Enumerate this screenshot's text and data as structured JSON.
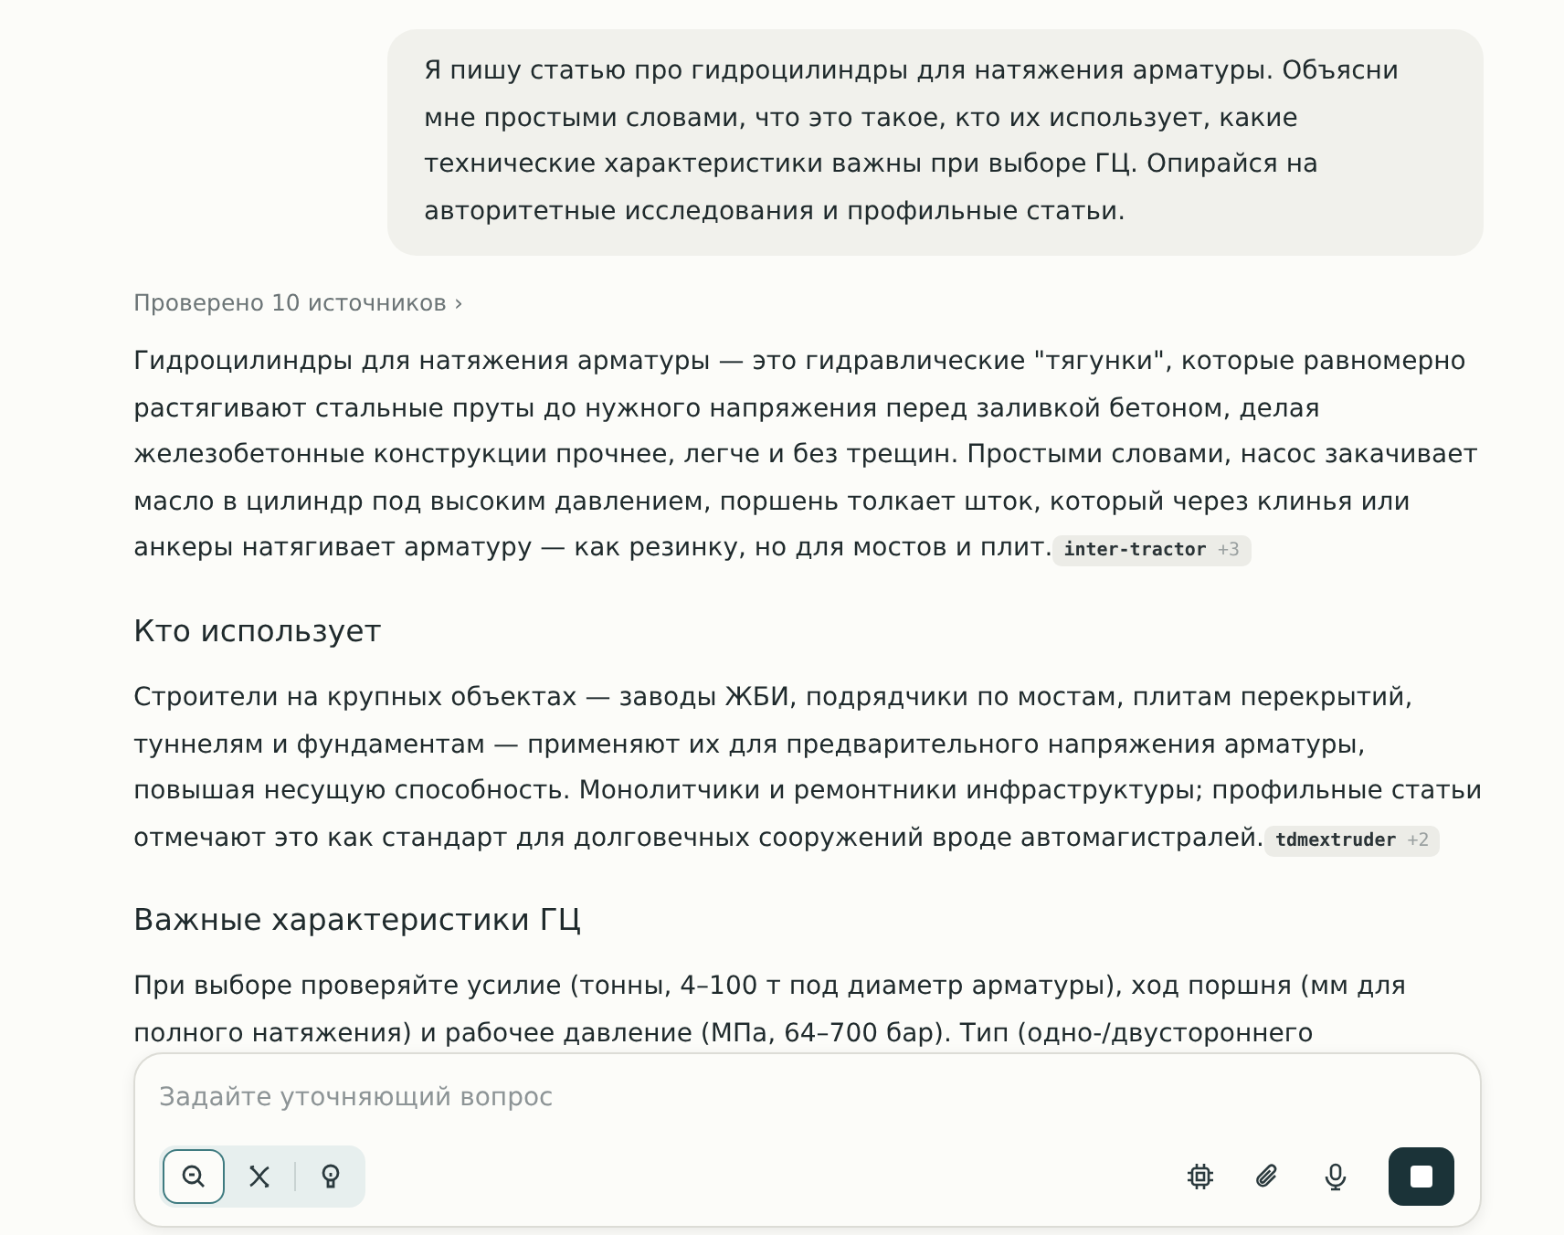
{
  "user_message": "Я пишу статью про гидроцилиндры для натяжения арматуры. Объясни мне простыми словами, что это такое, кто их использует, какие технические характеристики важны при выборе ГЦ. Опирайся на авторитетные исследования и профильные статьи.",
  "sources_link": {
    "label": "Проверено 10 источников",
    "chevron": "›"
  },
  "answer": [
    {
      "kind": "paragraph",
      "text": "Гидроцилиндры для натяжения арматуры — это гидравлические \"тягунки\", которые равномерно растягивают стальные пруты до нужного напряжения перед заливкой бетоном, делая железобетонные конструкции прочнее, легче и без трещин. Простыми словами, насос закачивает масло в цилиндр под высоким давлением, поршень толкает шток, который через клинья или анкеры натягивает арматуру — как резинку, но для мостов и плит.",
      "citation": {
        "source": "inter-tractor",
        "more": "+3"
      }
    },
    {
      "kind": "heading",
      "text": "Кто использует"
    },
    {
      "kind": "paragraph",
      "text": "Строители на крупных объектах — заводы ЖБИ, подрядчики по мостам, плитам перекрытий, туннелям и фундаментам — применяют их для предварительного напряжения арматуры, повышая несущую способность. Монолитчики и ремонтники инфраструктуры; профильные статьи отмечают это как стандарт для долговечных сооружений вроде автомагистралей.",
      "citation": {
        "source": "tdmextruder",
        "more": "+2"
      }
    },
    {
      "kind": "heading",
      "text": "Важные характеристики ГЦ"
    },
    {
      "kind": "paragraph",
      "text": "При выборе проверяйте усилие (тонны, 4–100 т под диаметр арматуры), ход поршня (мм для полного натяжения) и рабочее давление (МПа, 64–700 бар). Тип (одно-/двустороннего"
    }
  ],
  "composer": {
    "placeholder": "Задайте уточняющий вопрос",
    "modes": [
      {
        "kind": "search",
        "selected": true
      },
      {
        "kind": "research",
        "selected": false
      },
      {
        "kind": "labs",
        "selected": false
      }
    ],
    "tools": [
      {
        "kind": "chip"
      },
      {
        "kind": "attach"
      },
      {
        "kind": "mic"
      }
    ]
  }
}
